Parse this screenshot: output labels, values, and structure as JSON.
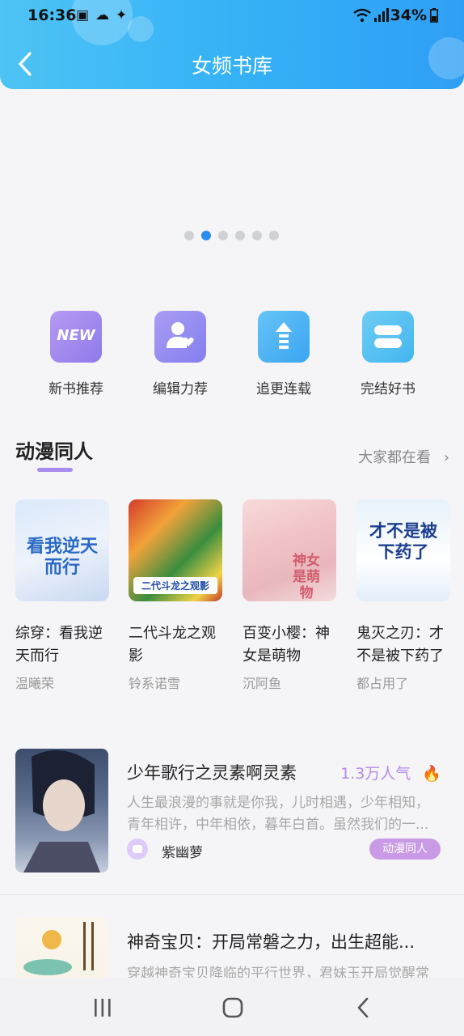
{
  "status": {
    "time": "16:36",
    "battery": "34%"
  },
  "header": {
    "title": "女频书库"
  },
  "carousel": {
    "count": 6,
    "active": 1
  },
  "categories": [
    {
      "label": "新书推荐",
      "icon": "new-badge-icon",
      "badge_text": "NEW",
      "color": "#a88bef"
    },
    {
      "label": "编辑力荐",
      "icon": "editor-heart-icon",
      "color": "#9d8cf0"
    },
    {
      "label": "追更连载",
      "icon": "upload-arrow-icon",
      "color": "#4eb7f4"
    },
    {
      "label": "完结好书",
      "icon": "finished-book-icon",
      "color": "#53c0f1"
    }
  ],
  "section": {
    "title": "动漫同人",
    "more": "大家都在看"
  },
  "books": [
    {
      "name": "综穿：看我逆天而行",
      "author": "温曦荣",
      "cover_text": "看我逆天而行"
    },
    {
      "name": "二代斗龙之观影",
      "author": "铃系诺雪",
      "cover_text": "二代斗龙之观影"
    },
    {
      "name": "百变小樱：神女是萌物",
      "author": "沉阿鱼",
      "cover_text": "神女是萌物"
    },
    {
      "name": "鬼灭之刃：才不是被下药了",
      "author": "都占用了",
      "cover_text": "才不是被下药了"
    }
  ],
  "list": [
    {
      "title": "少年歌行之灵素啊灵素",
      "popularity": "1.3万人气",
      "desc": "人生最浪漫的事就是你我，儿时相遇，少年相知，青年相许，中年相依，暮年白首。虽然我们的一...",
      "author": "紫幽萝",
      "tag": "动漫同人"
    },
    {
      "title": "神奇宝贝：开局常磐之力，出生超能...",
      "desc": "穿越神奇宝贝降临的平行世界，君妹玉开局觉醒常"
    }
  ]
}
